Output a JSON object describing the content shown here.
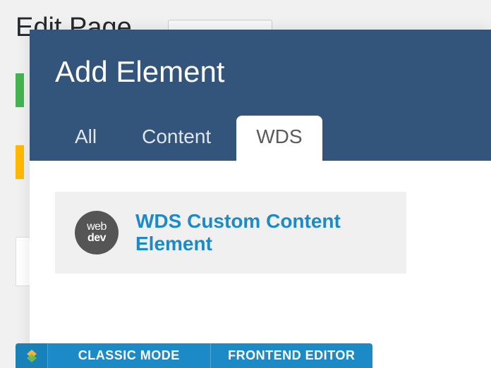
{
  "page": {
    "heading": "Edit Page"
  },
  "modal": {
    "title": "Add Element",
    "tabs": [
      {
        "label": "All"
      },
      {
        "label": "Content"
      },
      {
        "label": "WDS",
        "active": true
      }
    ],
    "element": {
      "badge_line1": "web",
      "badge_line2": "dev",
      "name": "WDS Custom Content Element"
    }
  },
  "mode_bar": {
    "classic": "CLASSIC MODE",
    "frontend": "FRONTEND EDITOR"
  }
}
